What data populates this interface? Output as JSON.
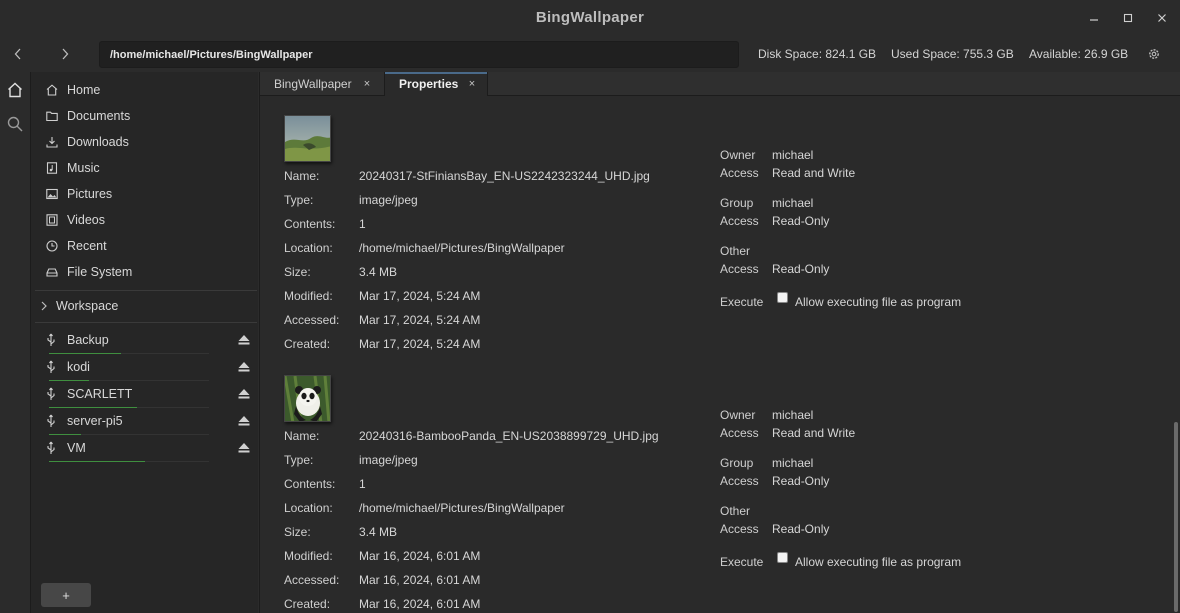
{
  "window": {
    "title": "BingWallpaper"
  },
  "toolbar": {
    "path": "/home/michael/Pictures/BingWallpaper",
    "disk_space": "Disk Space: 824.1 GB",
    "used_space": "Used Space: 755.3 GB",
    "available": "Available: 26.9 GB"
  },
  "sidebar": {
    "places": [
      {
        "label": "Home",
        "icon": "home-icon"
      },
      {
        "label": "Documents",
        "icon": "folder-icon"
      },
      {
        "label": "Downloads",
        "icon": "download-icon"
      },
      {
        "label": "Music",
        "icon": "music-icon"
      },
      {
        "label": "Pictures",
        "icon": "image-icon"
      },
      {
        "label": "Videos",
        "icon": "film-icon"
      },
      {
        "label": "Recent",
        "icon": "clock-icon"
      },
      {
        "label": "File System",
        "icon": "drive-icon"
      }
    ],
    "workspace_label": "Workspace",
    "drives": [
      {
        "label": "Backup",
        "usage": 0.45
      },
      {
        "label": "kodi",
        "usage": 0.25
      },
      {
        "label": "SCARLETT",
        "usage": 0.55
      },
      {
        "label": "server-pi5",
        "usage": 0.2
      },
      {
        "label": "VM",
        "usage": 0.6
      }
    ],
    "add_label": "+"
  },
  "tabs": [
    {
      "label": "BingWallpaper",
      "close": "×",
      "active": false
    },
    {
      "label": "Properties",
      "close": "×",
      "active": true
    }
  ],
  "properties": [
    {
      "labels": {
        "name": "Name:",
        "type": "Type:",
        "contents": "Contents:",
        "location": "Location:",
        "size": "Size:",
        "modified": "Modified:",
        "accessed": "Accessed:",
        "created": "Created:"
      },
      "name": "20240317-StFiniansBay_EN-US2242323244_UHD.jpg",
      "type": "image/jpeg",
      "contents": "1",
      "location": "/home/michael/Pictures/BingWallpaper",
      "size": "3.4 MB",
      "modified": "Mar 17, 2024, 5:24 AM",
      "accessed": "Mar 17, 2024, 5:24 AM",
      "created": "Mar 17, 2024, 5:24 AM",
      "permissions": {
        "owner_label": "Owner",
        "owner": "michael",
        "owner_access_label": "Access",
        "owner_access": "Read and Write",
        "group_label": "Group",
        "group": "michael",
        "group_access_label": "Access",
        "group_access": "Read-Only",
        "other_label": "Other",
        "other_access_label": "Access",
        "other_access": "Read-Only",
        "execute_label": "Execute",
        "execute_option": "Allow executing file as program",
        "execute_checked": false
      }
    },
    {
      "labels": {
        "name": "Name:",
        "type": "Type:",
        "contents": "Contents:",
        "location": "Location:",
        "size": "Size:",
        "modified": "Modified:",
        "accessed": "Accessed:",
        "created": "Created:"
      },
      "name": "20240316-BambooPanda_EN-US2038899729_UHD.jpg",
      "type": "image/jpeg",
      "contents": "1",
      "location": "/home/michael/Pictures/BingWallpaper",
      "size": "3.4 MB",
      "modified": "Mar 16, 2024, 6:01 AM",
      "accessed": "Mar 16, 2024, 6:01 AM",
      "created": "Mar 16, 2024, 6:01 AM",
      "permissions": {
        "owner_label": "Owner",
        "owner": "michael",
        "owner_access_label": "Access",
        "owner_access": "Read and Write",
        "group_label": "Group",
        "group": "michael",
        "group_access_label": "Access",
        "group_access": "Read-Only",
        "other_label": "Other",
        "other_access_label": "Access",
        "other_access": "Read-Only",
        "execute_label": "Execute",
        "execute_option": "Allow executing file as program",
        "execute_checked": false
      }
    }
  ],
  "colors": {
    "background": "#2b2b2b",
    "sidebar": "#262626",
    "usage_bar": "#3f8f3f",
    "tab_accent": "#4a6a8a"
  }
}
